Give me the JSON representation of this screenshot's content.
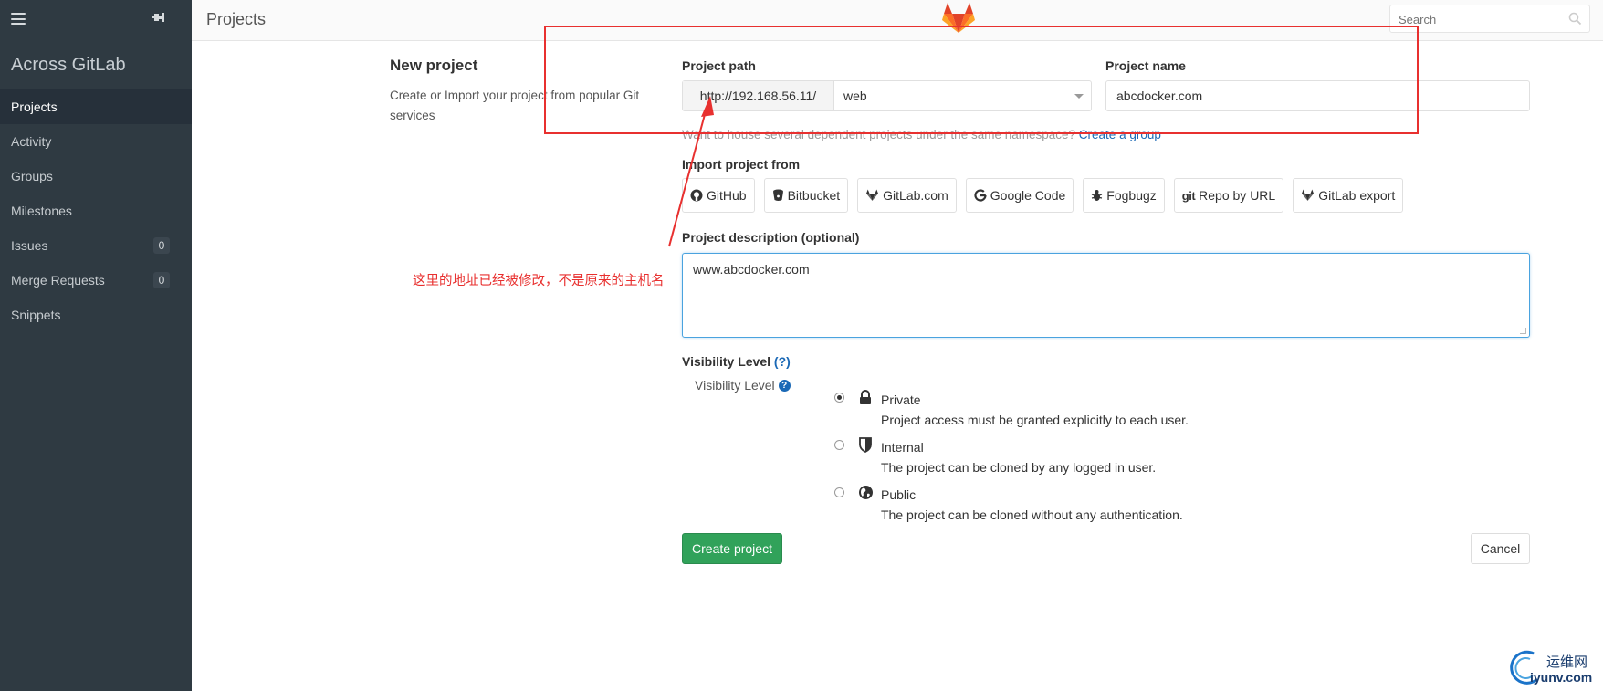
{
  "sidebar": {
    "brand": "Across GitLab",
    "items": [
      {
        "label": "Projects",
        "active": true,
        "badge": null
      },
      {
        "label": "Activity",
        "active": false,
        "badge": null
      },
      {
        "label": "Groups",
        "active": false,
        "badge": null
      },
      {
        "label": "Milestones",
        "active": false,
        "badge": null
      },
      {
        "label": "Issues",
        "active": false,
        "badge": "0"
      },
      {
        "label": "Merge Requests",
        "active": false,
        "badge": "0"
      },
      {
        "label": "Snippets",
        "active": false,
        "badge": null
      }
    ]
  },
  "header": {
    "title": "Projects",
    "search_placeholder": "Search"
  },
  "intro": {
    "title": "New project",
    "description": "Create or Import your project from popular Git services"
  },
  "form": {
    "path_label": "Project path",
    "path_prefix": "http://192.168.56.11/",
    "path_namespace": "web",
    "name_label": "Project name",
    "name_value": "abcdocker.com",
    "help_text": "Want to house several dependent projects under the same namespace?",
    "help_link": "Create a group",
    "import_label": "Import project from",
    "import_sources": [
      {
        "label": "GitHub",
        "icon": "github-icon"
      },
      {
        "label": "Bitbucket",
        "icon": "bitbucket-icon"
      },
      {
        "label": "GitLab.com",
        "icon": "gitlab-icon"
      },
      {
        "label": "Google Code",
        "icon": "google-icon"
      },
      {
        "label": "Fogbugz",
        "icon": "bug-icon"
      },
      {
        "label": "Repo by URL",
        "icon": "git-icon"
      },
      {
        "label": "GitLab export",
        "icon": "gitlab-icon"
      }
    ],
    "description_label": "Project description (optional)",
    "description_value": "www.abcdocker.com",
    "visibility_title": "Visibility Level",
    "visibility_help": "(?)",
    "visibility_sub": "Visibility Level",
    "visibility_options": [
      {
        "name": "Private",
        "desc": "Project access must be granted explicitly to each user.",
        "checked": true,
        "icon": "lock-icon"
      },
      {
        "name": "Internal",
        "desc": "The project can be cloned by any logged in user.",
        "checked": false,
        "icon": "shield-icon"
      },
      {
        "name": "Public",
        "desc": "The project can be cloned without any authentication.",
        "checked": false,
        "icon": "globe-icon"
      }
    ],
    "create_label": "Create project",
    "cancel_label": "Cancel"
  },
  "annotation": {
    "text": "这里的地址已经被修改，不是原来的主机名",
    "color": "#e8302f"
  },
  "watermark": {
    "cn": "运维网",
    "en": "iyunv.com"
  },
  "colors": {
    "sidebar_bg": "#2f3a42",
    "primary_green": "#31a25a",
    "link_blue": "#1b69b6"
  }
}
